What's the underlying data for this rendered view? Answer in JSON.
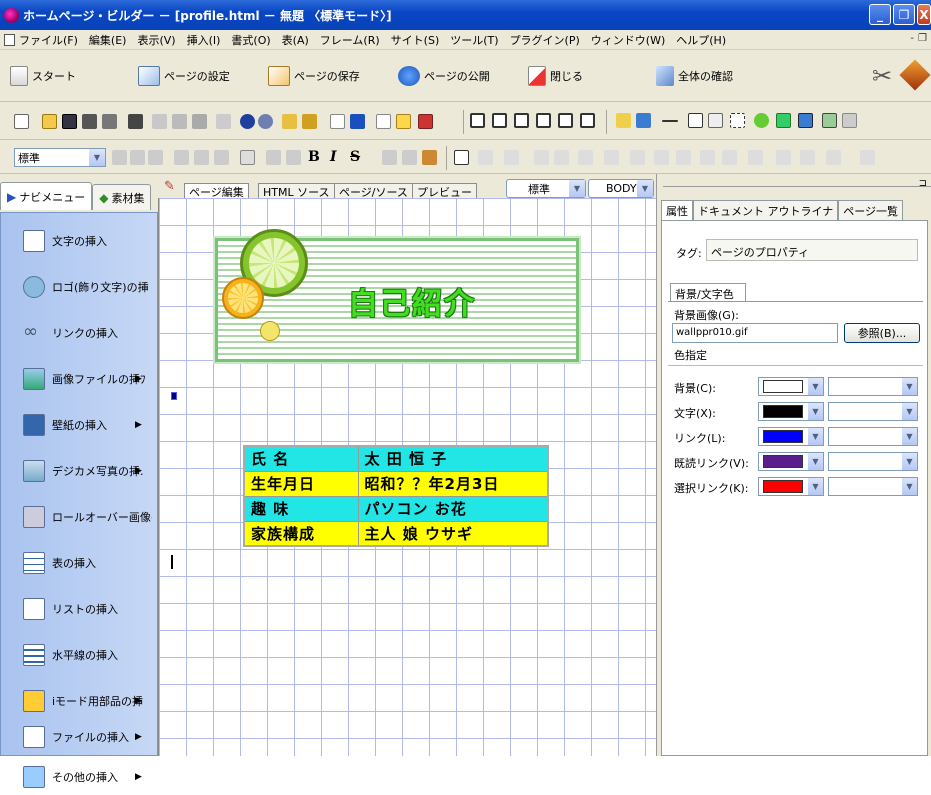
{
  "window": {
    "title": "ホームページ・ビルダー － [profile.html － 無題 〈標準モード〉]",
    "controls": {
      "minimize": "_",
      "maximize": "❐",
      "close": "X"
    }
  },
  "menu": {
    "items": [
      "ファイル(F)",
      "編集(E)",
      "表示(V)",
      "挿入(I)",
      "書式(O)",
      "表(A)",
      "フレーム(R)",
      "サイト(S)",
      "ツール(T)",
      "プラグイン(P)",
      "ウィンドウ(W)",
      "ヘルプ(H)"
    ],
    "mdi_controls": [
      "-",
      "❐"
    ]
  },
  "bigbar": {
    "start": "スタート",
    "page_settings": "ページの設定",
    "page_save": "ページの保存",
    "page_publish": "ページの公開",
    "close": "閉じる",
    "check_all": "全体の確認"
  },
  "format_bar": {
    "style_select": "標準",
    "bold": "B",
    "italic": "I",
    "strike": "S"
  },
  "left_panel": {
    "tabs": [
      "ナビメニュー",
      "素材集"
    ],
    "items": [
      {
        "label": "文字の挿入",
        "arrow": ""
      },
      {
        "label": "ロゴ(飾り文字)の挿",
        "arrow": ""
      },
      {
        "label": "リンクの挿入",
        "arrow": ""
      },
      {
        "label": "画像ファイルの挿ﾌ",
        "arrow": "▶"
      },
      {
        "label": "壁紙の挿入",
        "arrow": "▶"
      },
      {
        "label": "デジカメ写真の挿.",
        "arrow": "▶"
      },
      {
        "label": "ロールオーバー画像(",
        "arrow": ""
      },
      {
        "label": "表の挿入",
        "arrow": ""
      },
      {
        "label": "リストの挿入",
        "arrow": ""
      },
      {
        "label": "水平線の挿入",
        "arrow": ""
      },
      {
        "label": "iモード用部品の挿",
        "arrow": "▶"
      },
      {
        "label": "ファイルの挿入",
        "arrow": "▶"
      },
      {
        "label": "その他の挿入",
        "arrow": "▶"
      }
    ]
  },
  "editor": {
    "tabs": [
      "ページ編集",
      "HTML ソース",
      "ページ/ソース",
      "プレビュー"
    ],
    "style_select": "標準",
    "tag_select": "BODY",
    "banner_title": "自己紹介",
    "profile_table": [
      [
        "氏 名",
        "太 田 恒 子"
      ],
      [
        "生年月日",
        "昭和？？年2月3日"
      ],
      [
        "趣 味",
        "パソコン お花"
      ],
      [
        "家族構成",
        "主人 娘 ウサギ"
      ]
    ],
    "row_colors": [
      "#22e5e5",
      "#ffff00",
      "#22e5e5",
      "#ffff00"
    ]
  },
  "right_panel": {
    "tabs": [
      "属性",
      "ドキュメント アウトライナ",
      "ページ一覧"
    ],
    "tag_label": "タグ:",
    "tag_value": "ページのプロパティ",
    "subtab": "背景/文字色",
    "bg_image_label": "背景画像(G):",
    "bg_image_value": "wallppr010.gif",
    "browse_button": "参照(B)...",
    "color_section": "色指定",
    "colors": [
      {
        "label": "背景(C):",
        "color": "#ffffff"
      },
      {
        "label": "文字(X):",
        "color": "#000000"
      },
      {
        "label": "リンク(L):",
        "color": "#0000ff"
      },
      {
        "label": "既読リンク(V):",
        "color": "#5a1e8c"
      },
      {
        "label": "選択リンク(K):",
        "color": "#ff0000"
      }
    ]
  }
}
